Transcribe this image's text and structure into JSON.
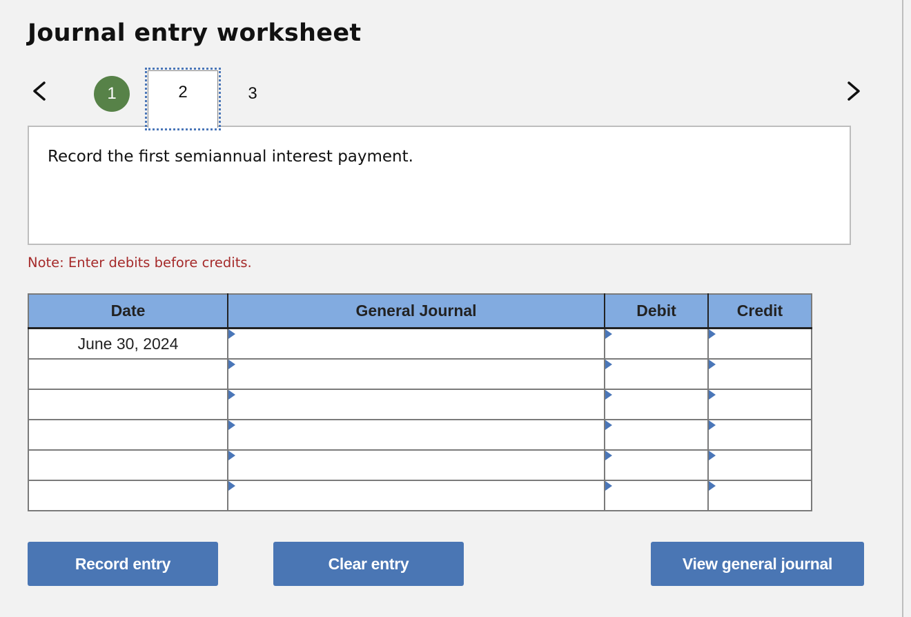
{
  "page": {
    "title": "Journal entry worksheet",
    "prompt": "Record the first semiannual interest payment.",
    "note": "Note: Enter debits before credits."
  },
  "steps": {
    "prev_icon": "chevron-left-icon",
    "next_icon": "chevron-right-icon",
    "items": [
      {
        "label": "1",
        "state": "completed"
      },
      {
        "label": "2",
        "state": "active"
      },
      {
        "label": "3",
        "state": "upcoming"
      }
    ],
    "completed_color": "#578248"
  },
  "journal": {
    "headers": {
      "date": "Date",
      "general_journal": "General Journal",
      "debit": "Debit",
      "credit": "Credit"
    },
    "rows": [
      {
        "date": "June 30, 2024",
        "account": "",
        "debit": "",
        "credit": ""
      },
      {
        "date": "",
        "account": "",
        "debit": "",
        "credit": ""
      },
      {
        "date": "",
        "account": "",
        "debit": "",
        "credit": ""
      },
      {
        "date": "",
        "account": "",
        "debit": "",
        "credit": ""
      },
      {
        "date": "",
        "account": "",
        "debit": "",
        "credit": ""
      },
      {
        "date": "",
        "account": "",
        "debit": "",
        "credit": ""
      }
    ],
    "header_color": "#82abe0",
    "input_border_color": "#4a76b8"
  },
  "buttons": {
    "record": "Record entry",
    "clear": "Clear entry",
    "view": "View general journal",
    "color": "#4a76b4"
  }
}
